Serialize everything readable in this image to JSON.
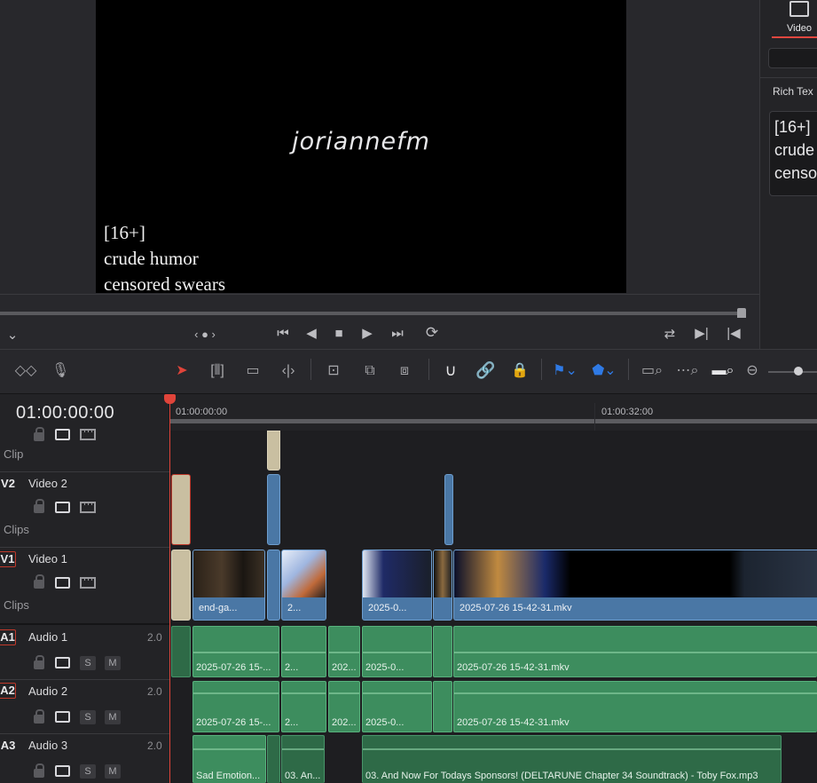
{
  "viewer": {
    "watermark": "joriannefm",
    "overlay_lines": [
      "[16+]",
      "crude humor",
      "censored swears"
    ],
    "nav_dots": "‹ ● ›"
  },
  "inspector": {
    "tab_label": "Video",
    "section_title": "Rich Tex",
    "text_lines": [
      "[16+]",
      "crude",
      "censo"
    ]
  },
  "timeline": {
    "timecode": "01:00:00:00",
    "ruler_labels": [
      "01:00:00:00",
      "01:00:32:00"
    ],
    "tracks": {
      "v3_sub": "Clip",
      "v2": {
        "id": "V2",
        "name": "Video 2",
        "sub": "Clips"
      },
      "v1": {
        "id": "V1",
        "name": "Video 1",
        "sub": "Clips"
      },
      "a1": {
        "id": "A1",
        "name": "Audio 1",
        "level": "2.0"
      },
      "a2": {
        "id": "A2",
        "name": "Audio 2",
        "level": "2.0"
      },
      "a3": {
        "id": "A3",
        "name": "Audio 3",
        "level": "2.0"
      }
    },
    "solo_label": "S",
    "mute_label": "M",
    "video_clips": [
      "end-ga...",
      "2...",
      "2025-0...",
      "2025-07-26 15-42-31.mkv"
    ],
    "audio1_clips": [
      "2025-07-26 15-...",
      "2...",
      "202...",
      "2025-0...",
      "2025-07-26 15-42-31.mkv"
    ],
    "audio2_clips": [
      "2025-07-26 15-...",
      "2...",
      "202...",
      "2025-0...",
      "2025-07-26 15-42-31.mkv"
    ],
    "audio3_clips": [
      "Sad Emotion...",
      "03. An...",
      "03. And Now For Todays Sponsors! (DELTARUNE Chapter 34 Soundtrack) - Toby Fox.mp3"
    ]
  },
  "colors": {
    "playhead": "#e0443a",
    "video_clip": "#4a77a5",
    "audio_clip": "#3d8d5e",
    "beige_clip": "#c9bfa1"
  }
}
